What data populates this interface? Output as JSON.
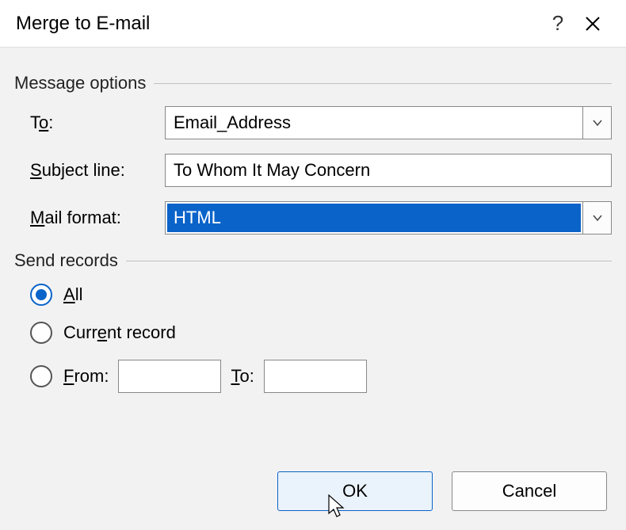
{
  "title": "Merge to E-mail",
  "groups": {
    "message": {
      "title": "Message options",
      "to_label": "To:",
      "to_value": "Email_Address",
      "subject_label": "Subject line:",
      "subject_underline": "S",
      "subject_rest": "ubject line:",
      "subject_value": "To Whom It May Concern",
      "format_label": "Mail format:",
      "format_underline": "M",
      "format_rest": "ail format:",
      "format_value": "HTML"
    },
    "send": {
      "title": "Send records",
      "all_underline": "A",
      "all_rest": "ll",
      "current_pre": "Curr",
      "current_underline": "e",
      "current_post": "nt record",
      "from_underline": "F",
      "from_rest": "rom:",
      "to_underline": "T",
      "to_rest": "o:",
      "from_value": "",
      "to_value": ""
    }
  },
  "buttons": {
    "ok": "OK",
    "cancel": "Cancel"
  },
  "selected_radio": "all"
}
